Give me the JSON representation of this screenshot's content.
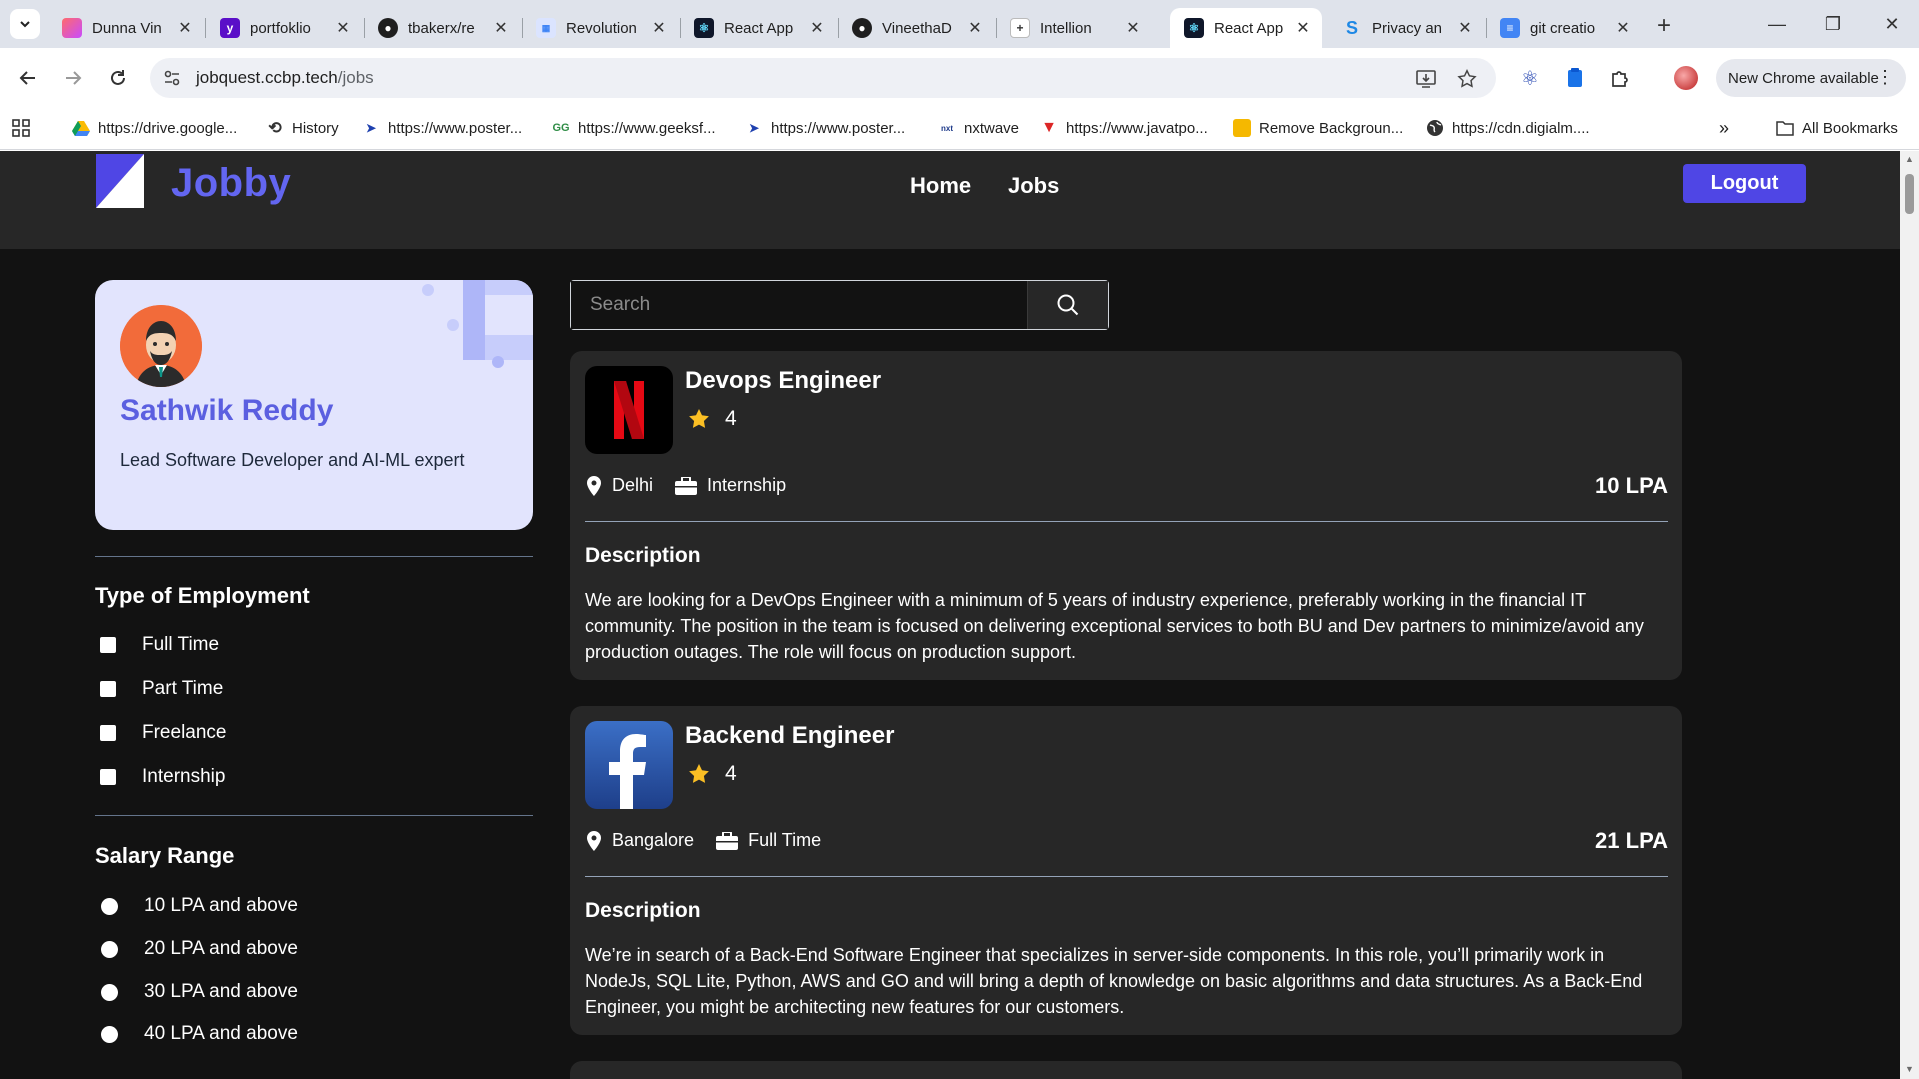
{
  "browser": {
    "tabs": [
      {
        "title": "Dunna Vin",
        "favicon_color": "#e84393"
      },
      {
        "title": "portfoklio",
        "favicon_color": "#5a0fc8"
      },
      {
        "title": "tbakerx/re",
        "favicon_color": "#1f1f1f"
      },
      {
        "title": "Revolution",
        "favicon_color": "#3b82f6"
      },
      {
        "title": "React App",
        "favicon_color": "#0f172a"
      },
      {
        "title": "VineethaD",
        "favicon_color": "#1f1f1f"
      },
      {
        "title": "Intellion",
        "favicon_color": "#ffffff"
      },
      {
        "title": "React App",
        "favicon_color": "#0f172a",
        "active": true
      },
      {
        "title": "Privacy an",
        "favicon_color": "#1e88e5"
      },
      {
        "title": "git creatio",
        "favicon_color": "#4285f4"
      }
    ],
    "url_host": "jobquest.ccbp.tech",
    "url_path": "/jobs",
    "update_label": "New Chrome available",
    "bookmarks": [
      {
        "label": "https://drive.google...",
        "icon": "drive-icon"
      },
      {
        "label": "History",
        "icon": "history-icon"
      },
      {
        "label": "https://www.poster...",
        "icon": "postman-icon"
      },
      {
        "label": "https://www.geeksf...",
        "icon": "geeks-icon"
      },
      {
        "label": "https://www.poster...",
        "icon": "postman-icon"
      },
      {
        "label": "nxtwave",
        "icon": "nxtwave-icon"
      },
      {
        "label": "https://www.javatpo...",
        "icon": "javatpoint-icon"
      },
      {
        "label": "Remove Backgroun...",
        "icon": "removebg-icon"
      },
      {
        "label": "https://cdn.digialm....",
        "icon": "globe-icon"
      }
    ],
    "all_bookmarks_label": "All Bookmarks"
  },
  "header": {
    "brand": "Jobby",
    "nav": {
      "home": "Home",
      "jobs": "Jobs"
    },
    "logout_label": "Logout"
  },
  "profile": {
    "name": "Sathwik Reddy",
    "bio": "Lead Software Developer and AI-ML expert"
  },
  "filters": {
    "employment_heading": "Type of Employment",
    "employment_options": [
      "Full Time",
      "Part Time",
      "Freelance",
      "Internship"
    ],
    "salary_heading": "Salary Range",
    "salary_options": [
      "10 LPA and above",
      "20 LPA and above",
      "30 LPA and above",
      "40 LPA and above"
    ]
  },
  "search": {
    "placeholder": "Search",
    "value": ""
  },
  "jobs": [
    {
      "title": "Devops Engineer",
      "rating": "4",
      "location": "Delhi",
      "employment_type": "Internship",
      "package": "10 LPA",
      "description_heading": "Description",
      "description": "We are looking for a DevOps Engineer with a minimum of 5 years of industry experience, preferably working in the financial IT community. The position in the team is focused on delivering exceptional services to both BU and Dev partners to minimize/avoid any production outages. The role will focus on production support.",
      "company": "netflix",
      "logo_icon": "netflix-logo-icon"
    },
    {
      "title": "Backend Engineer",
      "rating": "4",
      "location": "Bangalore",
      "employment_type": "Full Time",
      "package": "21 LPA",
      "description_heading": "Description",
      "description": "We’re in search of a Back-End Software Engineer that specializes in server-side components. In this role, you’ll primarily work in NodeJs, SQL Lite, Python, AWS and GO and will bring a depth of knowledge on basic algorithms and data structures. As a Back-End Engineer, you might be architecting new features for our customers.",
      "company": "facebook",
      "logo_icon": "facebook-logo-icon"
    }
  ],
  "colors": {
    "accent": "#4f46e5",
    "brand": "#6366f1",
    "card": "#272727",
    "background": "#121212",
    "star": "#fbbf24"
  }
}
